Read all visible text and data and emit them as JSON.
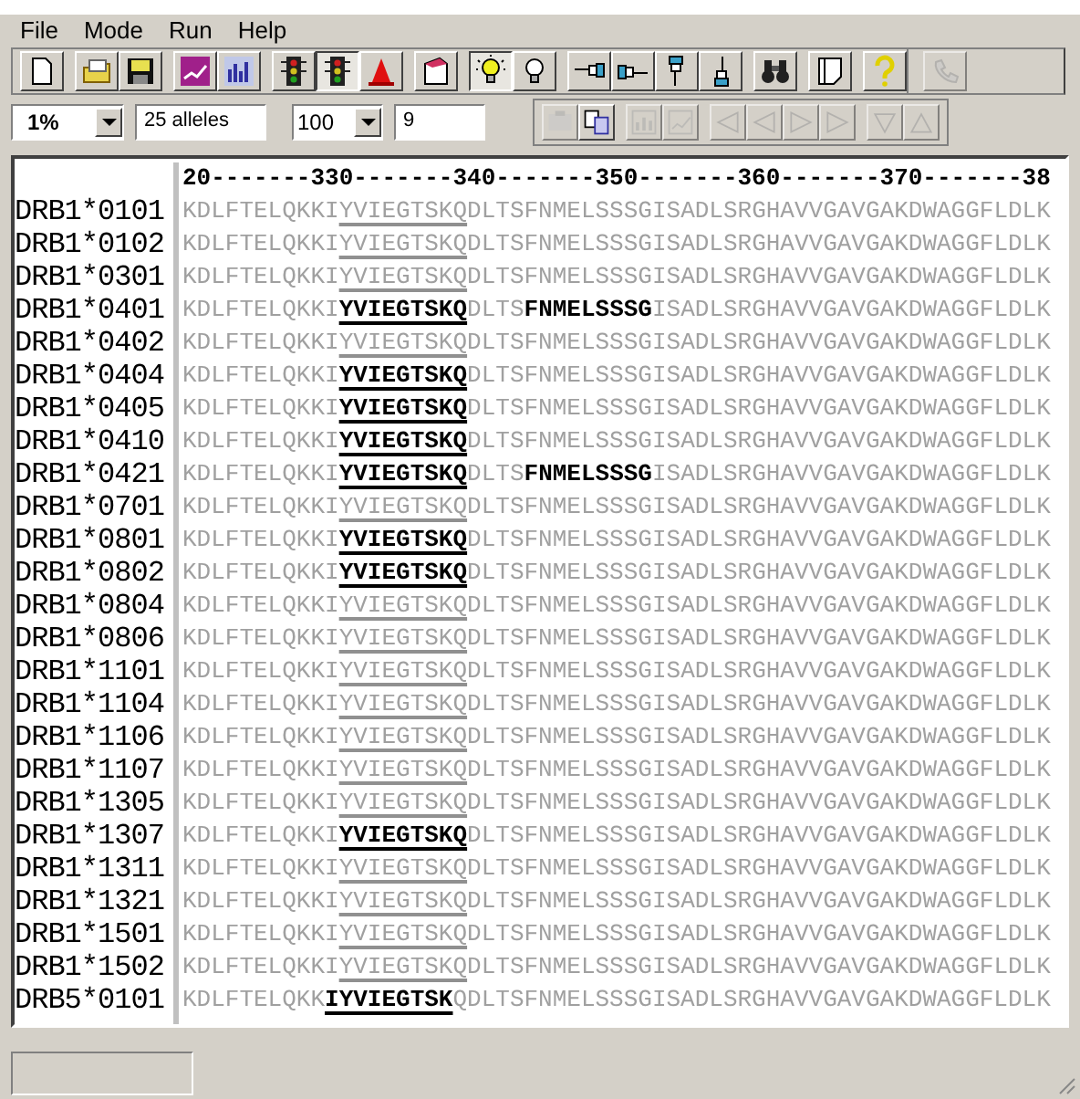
{
  "menu": [
    "File",
    "Mode",
    "Run",
    "Help"
  ],
  "toolbar": {
    "buttons": [
      {
        "pressed": false,
        "disabled": false
      },
      {
        "pressed": false,
        "disabled": false
      },
      {
        "pressed": false,
        "disabled": false
      },
      {
        "pressed": false,
        "disabled": false
      },
      {
        "pressed": false,
        "disabled": false
      },
      {
        "pressed": false,
        "disabled": false
      },
      {
        "pressed": true,
        "disabled": false
      },
      {
        "pressed": false,
        "disabled": false
      },
      {
        "pressed": false,
        "disabled": false
      },
      {
        "pressed": true,
        "disabled": false
      },
      {
        "pressed": false,
        "disabled": false
      },
      {
        "pressed": false,
        "disabled": false
      },
      {
        "pressed": false,
        "disabled": false
      },
      {
        "pressed": false,
        "disabled": false
      },
      {
        "pressed": false,
        "disabled": false
      },
      {
        "pressed": false,
        "disabled": false
      },
      {
        "pressed": false,
        "disabled": false
      },
      {
        "pressed": false,
        "disabled": false
      },
      {
        "pressed": false,
        "disabled": true
      }
    ]
  },
  "options": {
    "threshold": "1%",
    "alleles": "25 alleles",
    "length": "100",
    "value": "9",
    "buttons": [
      {
        "disabled": true
      },
      {
        "disabled": false
      },
      {
        "disabled": true
      },
      {
        "disabled": true
      },
      {
        "disabled": true
      },
      {
        "disabled": true
      },
      {
        "disabled": true
      },
      {
        "disabled": true
      },
      {
        "disabled": true
      },
      {
        "disabled": true
      }
    ]
  },
  "alignment": {
    "ruler": "20-------330-------340-------350-------360-------370-------38",
    "rows": [
      {
        "name": "DRB1*0101",
        "segments": [
          {
            "text": "KDLFTELQKKI",
            "kind": "plain"
          },
          {
            "text": "YVIEGTSKQ",
            "kind": "underlined"
          },
          {
            "text": "DLTSFNMELSSSGISADLSRGHAVVGAVGAKDWAGGFLDLK",
            "kind": "plain"
          }
        ]
      },
      {
        "name": "DRB1*0102",
        "segments": [
          {
            "text": "KDLFTELQKKI",
            "kind": "plain"
          },
          {
            "text": "YVIEGTSKQ",
            "kind": "underlined"
          },
          {
            "text": "DLTSFNMELSSSGISADLSRGHAVVGAVGAKDWAGGFLDLK",
            "kind": "plain"
          }
        ]
      },
      {
        "name": "DRB1*0301",
        "segments": [
          {
            "text": "KDLFTELQKKI",
            "kind": "plain"
          },
          {
            "text": "YVIEGTSKQ",
            "kind": "underlined"
          },
          {
            "text": "DLTSFNMELSSSGISADLSRGHAVVGAVGAKDWAGGFLDLK",
            "kind": "plain"
          }
        ]
      },
      {
        "name": "DRB1*0401",
        "segments": [
          {
            "text": "KDLFTELQKKI",
            "kind": "plain"
          },
          {
            "text": "YVIEGTSKQ",
            "kind": "bold-underlined"
          },
          {
            "text": "DLTS",
            "kind": "plain"
          },
          {
            "text": "FNMELSSSG",
            "kind": "bold"
          },
          {
            "text": "ISADLSRGHAVVGAVGAKDWAGGFLDLK",
            "kind": "plain"
          }
        ]
      },
      {
        "name": "DRB1*0402",
        "segments": [
          {
            "text": "KDLFTELQKKI",
            "kind": "plain"
          },
          {
            "text": "YVIEGTSKQ",
            "kind": "underlined"
          },
          {
            "text": "DLTSFNMELSSSGISADLSRGHAVVGAVGAKDWAGGFLDLK",
            "kind": "plain"
          }
        ]
      },
      {
        "name": "DRB1*0404",
        "segments": [
          {
            "text": "KDLFTELQKKI",
            "kind": "plain"
          },
          {
            "text": "YVIEGTSKQ",
            "kind": "bold-underlined"
          },
          {
            "text": "DLTSFNMELSSSGISADLSRGHAVVGAVGAKDWAGGFLDLK",
            "kind": "plain"
          }
        ]
      },
      {
        "name": "DRB1*0405",
        "segments": [
          {
            "text": "KDLFTELQKKI",
            "kind": "plain"
          },
          {
            "text": "YVIEGTSKQ",
            "kind": "bold-underlined"
          },
          {
            "text": "DLTSFNMELSSSGISADLSRGHAVVGAVGAKDWAGGFLDLK",
            "kind": "plain"
          }
        ]
      },
      {
        "name": "DRB1*0410",
        "segments": [
          {
            "text": "KDLFTELQKKI",
            "kind": "plain"
          },
          {
            "text": "YVIEGTSKQ",
            "kind": "bold-underlined"
          },
          {
            "text": "DLTSFNMELSSSGISADLSRGHAVVGAVGAKDWAGGFLDLK",
            "kind": "plain"
          }
        ]
      },
      {
        "name": "DRB1*0421",
        "segments": [
          {
            "text": "KDLFTELQKKI",
            "kind": "plain"
          },
          {
            "text": "YVIEGTSKQ",
            "kind": "bold-underlined"
          },
          {
            "text": "DLTS",
            "kind": "plain"
          },
          {
            "text": "FNMELSSSG",
            "kind": "bold"
          },
          {
            "text": "ISADLSRGHAVVGAVGAKDWAGGFLDLK",
            "kind": "plain"
          }
        ]
      },
      {
        "name": "DRB1*0701",
        "segments": [
          {
            "text": "KDLFTELQKKI",
            "kind": "plain"
          },
          {
            "text": "YVIEGTSKQ",
            "kind": "underlined"
          },
          {
            "text": "DLTSFNMELSSSGISADLSRGHAVVGAVGAKDWAGGFLDLK",
            "kind": "plain"
          }
        ]
      },
      {
        "name": "DRB1*0801",
        "segments": [
          {
            "text": "KDLFTELQKKI",
            "kind": "plain"
          },
          {
            "text": "YVIEGTSKQ",
            "kind": "bold-underlined"
          },
          {
            "text": "DLTSFNMELSSSGISADLSRGHAVVGAVGAKDWAGGFLDLK",
            "kind": "plain"
          }
        ]
      },
      {
        "name": "DRB1*0802",
        "segments": [
          {
            "text": "KDLFTELQKKI",
            "kind": "plain"
          },
          {
            "text": "YVIEGTSKQ",
            "kind": "bold-underlined"
          },
          {
            "text": "DLTSFNMELSSSGISADLSRGHAVVGAVGAKDWAGGFLDLK",
            "kind": "plain"
          }
        ]
      },
      {
        "name": "DRB1*0804",
        "segments": [
          {
            "text": "KDLFTELQKKI",
            "kind": "plain"
          },
          {
            "text": "YVIEGTSKQ",
            "kind": "underlined"
          },
          {
            "text": "DLTSFNMELSSSGISADLSRGHAVVGAVGAKDWAGGFLDLK",
            "kind": "plain"
          }
        ]
      },
      {
        "name": "DRB1*0806",
        "segments": [
          {
            "text": "KDLFTELQKKI",
            "kind": "plain"
          },
          {
            "text": "YVIEGTSKQ",
            "kind": "underlined"
          },
          {
            "text": "DLTSFNMELSSSGISADLSRGHAVVGAVGAKDWAGGFLDLK",
            "kind": "plain"
          }
        ]
      },
      {
        "name": "DRB1*1101",
        "segments": [
          {
            "text": "KDLFTELQKKI",
            "kind": "plain"
          },
          {
            "text": "YVIEGTSKQ",
            "kind": "underlined"
          },
          {
            "text": "DLTSFNMELSSSGISADLSRGHAVVGAVGAKDWAGGFLDLK",
            "kind": "plain"
          }
        ]
      },
      {
        "name": "DRB1*1104",
        "segments": [
          {
            "text": "KDLFTELQKKI",
            "kind": "plain"
          },
          {
            "text": "YVIEGTSKQ",
            "kind": "underlined"
          },
          {
            "text": "DLTSFNMELSSSGISADLSRGHAVVGAVGAKDWAGGFLDLK",
            "kind": "plain"
          }
        ]
      },
      {
        "name": "DRB1*1106",
        "segments": [
          {
            "text": "KDLFTELQKKI",
            "kind": "plain"
          },
          {
            "text": "YVIEGTSKQ",
            "kind": "underlined"
          },
          {
            "text": "DLTSFNMELSSSGISADLSRGHAVVGAVGAKDWAGGFLDLK",
            "kind": "plain"
          }
        ]
      },
      {
        "name": "DRB1*1107",
        "segments": [
          {
            "text": "KDLFTELQKKI",
            "kind": "plain"
          },
          {
            "text": "YVIEGTSKQ",
            "kind": "underlined"
          },
          {
            "text": "DLTSFNMELSSSGISADLSRGHAVVGAVGAKDWAGGFLDLK",
            "kind": "plain"
          }
        ]
      },
      {
        "name": "DRB1*1305",
        "segments": [
          {
            "text": "KDLFTELQKKI",
            "kind": "plain"
          },
          {
            "text": "YVIEGTSKQ",
            "kind": "underlined"
          },
          {
            "text": "DLTSFNMELSSSGISADLSRGHAVVGAVGAKDWAGGFLDLK",
            "kind": "plain"
          }
        ]
      },
      {
        "name": "DRB1*1307",
        "segments": [
          {
            "text": "KDLFTELQKKI",
            "kind": "plain"
          },
          {
            "text": "YVIEGTSKQ",
            "kind": "bold-underlined"
          },
          {
            "text": "DLTSFNMELSSSGISADLSRGHAVVGAVGAKDWAGGFLDLK",
            "kind": "plain"
          }
        ]
      },
      {
        "name": "DRB1*1311",
        "segments": [
          {
            "text": "KDLFTELQKKI",
            "kind": "plain"
          },
          {
            "text": "YVIEGTSKQ",
            "kind": "underlined"
          },
          {
            "text": "DLTSFNMELSSSGISADLSRGHAVVGAVGAKDWAGGFLDLK",
            "kind": "plain"
          }
        ]
      },
      {
        "name": "DRB1*1321",
        "segments": [
          {
            "text": "KDLFTELQKKI",
            "kind": "plain"
          },
          {
            "text": "YVIEGTSKQ",
            "kind": "underlined"
          },
          {
            "text": "DLTSFNMELSSSGISADLSRGHAVVGAVGAKDWAGGFLDLK",
            "kind": "plain"
          }
        ]
      },
      {
        "name": "DRB1*1501",
        "segments": [
          {
            "text": "KDLFTELQKKI",
            "kind": "plain"
          },
          {
            "text": "YVIEGTSKQ",
            "kind": "underlined"
          },
          {
            "text": "DLTSFNMELSSSGISADLSRGHAVVGAVGAKDWAGGFLDLK",
            "kind": "plain"
          }
        ]
      },
      {
        "name": "DRB1*1502",
        "segments": [
          {
            "text": "KDLFTELQKKI",
            "kind": "plain"
          },
          {
            "text": "YVIEGTSKQ",
            "kind": "underlined"
          },
          {
            "text": "DLTSFNMELSSSGISADLSRGHAVVGAVGAKDWAGGFLDLK",
            "kind": "plain"
          }
        ]
      },
      {
        "name": "DRB5*0101",
        "segments": [
          {
            "text": "KDLFTELQKK",
            "kind": "plain"
          },
          {
            "text": "IYVIEGTSK",
            "kind": "bold-underlined"
          },
          {
            "text": "QDLTSFNMELSSSGISADLSRGHAVVGAVGAKDWAGGFLDLK",
            "kind": "plain"
          }
        ]
      }
    ]
  }
}
